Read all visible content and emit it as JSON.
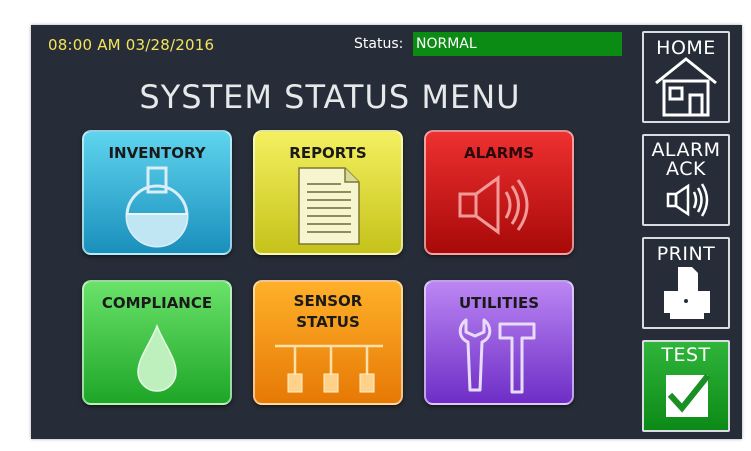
{
  "header": {
    "datetime": "08:00 AM 03/28/2016",
    "status_label": "Status:",
    "status_value": "NORMAL"
  },
  "title": "SYSTEM STATUS MENU",
  "tiles": [
    {
      "label": "INVENTORY",
      "icon": "flask-icon"
    },
    {
      "label": "REPORTS",
      "icon": "document-icon"
    },
    {
      "label": "ALARMS",
      "icon": "speaker-alarm-icon"
    },
    {
      "label": "COMPLIANCE",
      "icon": "droplet-icon"
    },
    {
      "label_line1": "SENSOR",
      "label_line2": "STATUS",
      "icon": "sensor-network-icon"
    },
    {
      "label": "UTILITIES",
      "icon": "wrench-hammer-icon"
    }
  ],
  "side_buttons": {
    "home": "HOME",
    "alarm_ack_line1": "ALARM",
    "alarm_ack_line2": "ACK",
    "print": "PRINT",
    "test": "TEST"
  },
  "colors": {
    "background": "#272d38",
    "status_normal": "#0b8a14",
    "datetime": "#f3e45a"
  }
}
